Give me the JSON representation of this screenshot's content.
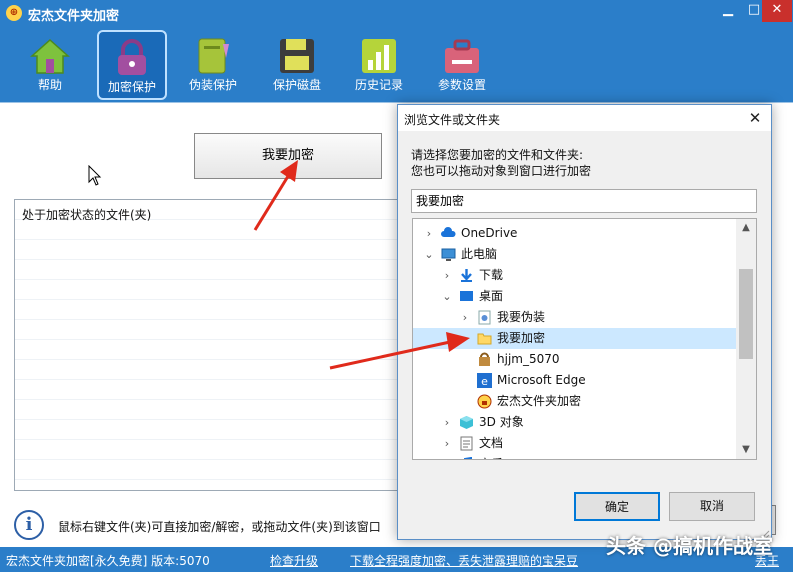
{
  "app": {
    "title": "宏杰文件夹加密",
    "window_controls": {
      "minimize": "▁",
      "maximize": "□",
      "close": "✕"
    }
  },
  "toolbar": {
    "items": [
      {
        "label": "帮助",
        "icon": "home-icon",
        "color": "#7ec23d"
      },
      {
        "label": "加密保护",
        "icon": "lock-icon",
        "color": "#a24fa0",
        "active": true
      },
      {
        "label": "伪装保护",
        "icon": "notebook-icon",
        "color": "#a6c43a"
      },
      {
        "label": "保护磁盘",
        "icon": "floppy-disk-icon",
        "color": "#e0e05a"
      },
      {
        "label": "历史记录",
        "icon": "bar-chart-icon",
        "color": "#b5d43a"
      },
      {
        "label": "参数设置",
        "icon": "toolbox-icon",
        "color": "#d9637a"
      }
    ]
  },
  "main": {
    "encrypt_button": "我要加密",
    "file_list_header": "处于加密状态的文件(夹)",
    "info_text": "鼠标右键文件(夹)可直接加密/解密，或拖动文件(夹)到该窗口"
  },
  "statusbar": {
    "version": "宏杰文件夹加密[永久免费]  版本:5070",
    "check_update": "检查升级",
    "download_link": "下载全程强度加密、丢失泄露理赔的宝呆豆",
    "right_link": "丢王"
  },
  "watermark": "头条 @搞机作战室",
  "dialog": {
    "title": "浏览文件或文件夹",
    "close": "✕",
    "instruction_line1": "请选择您要加密的文件和文件夹:",
    "instruction_line2": "您也可以拖动对象到窗口进行加密",
    "path_value": "我要加密",
    "tree": [
      {
        "label": "OneDrive",
        "icon": "cloud-icon",
        "twisty": "›",
        "level": 0
      },
      {
        "label": "此电脑",
        "icon": "computer-icon",
        "twisty": "⌄",
        "level": 0
      },
      {
        "label": "下载",
        "icon": "download-icon",
        "twisty": "›",
        "level": 1
      },
      {
        "label": "桌面",
        "icon": "desktop-icon",
        "twisty": "⌄",
        "level": 1
      },
      {
        "label": "我要伪装",
        "icon": "file-icon",
        "twisty": "›",
        "level": 2
      },
      {
        "label": "我要加密",
        "icon": "folder-icon",
        "twisty": "›",
        "level": 2,
        "selected": true
      },
      {
        "label": "hjjm_5070",
        "icon": "package-icon",
        "twisty": "",
        "level": 2
      },
      {
        "label": "Microsoft Edge",
        "icon": "edge-icon",
        "twisty": "",
        "level": 2
      },
      {
        "label": "宏杰文件夹加密",
        "icon": "app-lock-icon",
        "twisty": "",
        "level": 2
      },
      {
        "label": "3D 对象",
        "icon": "cube-icon",
        "twisty": "›",
        "level": 1
      },
      {
        "label": "文档",
        "icon": "document-icon",
        "twisty": "›",
        "level": 1
      },
      {
        "label": "音乐",
        "icon": "music-icon",
        "twisty": "›",
        "level": 1
      }
    ],
    "scroll_up": "▲",
    "scroll_down": "▼",
    "ok": "确定",
    "cancel": "取消"
  },
  "colors": {
    "accent": "#2b7ec9",
    "annotation_arrow": "#e02a1b",
    "selection": "#cce8ff"
  }
}
